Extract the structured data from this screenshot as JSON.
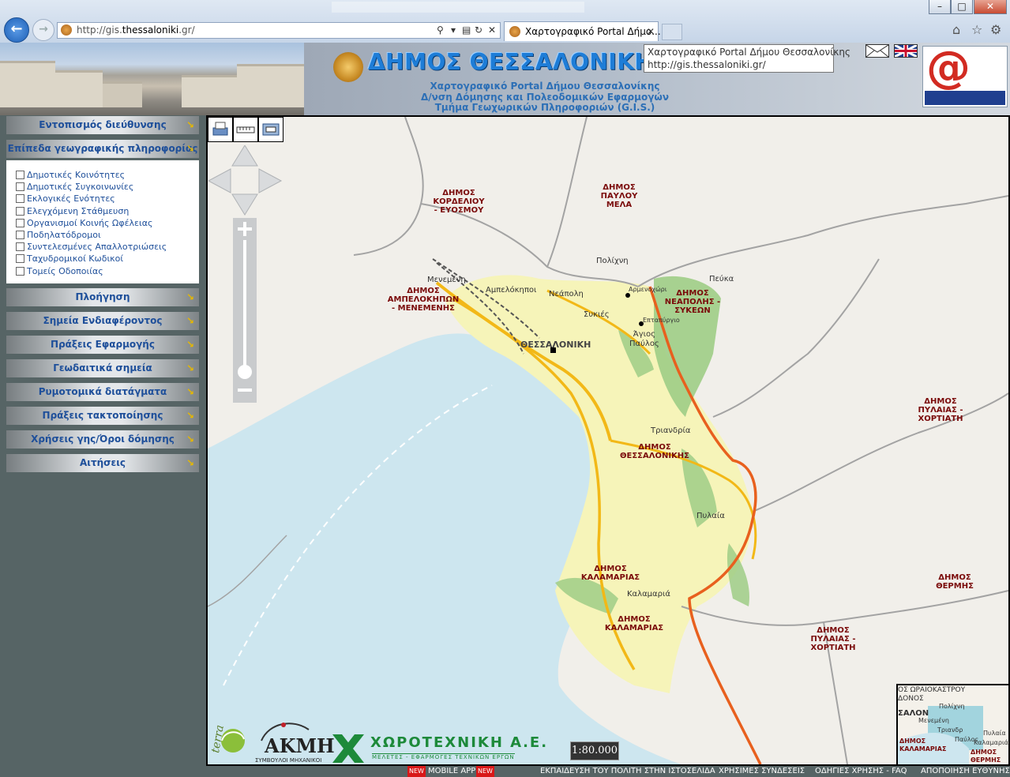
{
  "browser": {
    "url_prefix": "http://gis.",
    "url_domain": "thessaloniki",
    "url_suffix": ".gr/",
    "tab_title": "Χαρτογραφικό Portal Δήμο...",
    "window_minimize": "–",
    "window_maximize": "□",
    "window_close": "✕"
  },
  "header": {
    "title": "ΔΗΜΟΣ ΘΕΣΣΑΛΟΝΙΚΗΣ",
    "subtitle_1": "Χαρτογραφικό Portal Δήμου Θεσσαλονίκης",
    "subtitle_2": "Δ/νση Δόμησης και Πολεοδομικών Εφαρμογών",
    "subtitle_3": "Τμήμα Γεωχωρικών Πληροφοριών (G.I.S.)",
    "tooltip_line1": "Χαρτογραφικό Portal Δήμου Θεσσαλονίκης",
    "tooltip_line2": "http://gis.thessaloniki.gr/"
  },
  "sidebar": {
    "locate_address": "Εντοπισμός διεύθυνσης",
    "geo_layers": "Επίπεδα γεωγραφικής πληροφορίας",
    "layers": [
      "Δημοτικές Κοινότητες",
      "Δημοτικές Συγκοινωνίες",
      "Εκλογικές Ενότητες",
      "Ελεγχόμενη Στάθμευση",
      "Οργανισμοί Κοινής Ωφέλειας",
      "Ποδηλατόδρομοι",
      "Συντελεσμένες Απαλλοτριώσεις",
      "Ταχυδρομικοί Κωδικοί",
      "Τομείς Οδοποιίας"
    ],
    "menu": [
      "Πλοήγηση",
      "Σημεία Ενδιαφέροντος",
      "Πράξεις Εφαρμογής",
      "Γεωδαιτικά σημεία",
      "Ρυμοτομικά διατάγματα",
      "Πράξεις τακτοποίησης",
      "Χρήσεις γης/Όροι δόμησης",
      "Αιτήσεις"
    ],
    "arrow": "↘"
  },
  "map": {
    "scale": "1:80.000",
    "municipalities": {
      "kordelio": "ΔΗΜΟΣ\nΚΟΡΔΕΛΙΟΥ\n- ΕΥΟΣΜΟΥ",
      "pavlou_mela": "ΔΗΜΟΣ\nΠΑΥΛΟΥ\nΜΕΛΑ",
      "ampelokipoi": "ΔΗΜΟΣ\nΑΜΠΕΛΟΚΗΠΩΝ\n- ΜΕΝΕΜΕΝΗΣ",
      "neapoli": "ΔΗΜΟΣ\nΝΕΑΠΟΛΗΣ -\nΣΥΚΕΩΝ",
      "thessaloniki": "ΔΗΜΟΣ\nΘΕΣΣΑΛΟΝΙΚΗΣ",
      "pylaia_1": "ΔΗΜΟΣ\nΠΥΛΑΙΑΣ -\nΧΟΡΤΙΑΤΗ",
      "pylaia_2": "ΔΗΜΟΣ\nΠΥΛΑΙΑΣ -\nΧΟΡΤΙΑΤΗ",
      "kalamaria_1": "ΔΗΜΟΣ\nΚΑΛΑΜΑΡΙΑΣ",
      "kalamaria_2": "ΔΗΜΟΣ\nΚΑΛΑΜΑΡΙΑΣ",
      "thermi": "ΔΗΜΟΣ\nΘΕΡΜΗΣ"
    },
    "places": {
      "polichni": "Πολίχνη",
      "pefka": "Πεύκα",
      "menemeni": "Μενεμένη",
      "ampelokipoi": "Αμπελόκηποι",
      "neapoli": "Νεάπολη",
      "armenochori": "Αρμενοχώρι",
      "sykies": "Συκιές",
      "eptapyrgio": "Επταπύργιο",
      "agios_pavlos": "Άγιος\nΠαύλος",
      "thessaloniki": "ΘΕΣΣΑΛΟΝΙΚΗ",
      "triandria": "Τριανδρία",
      "pylaia": "Πυλαία",
      "kalamaria": "Καλαμαριά"
    },
    "overview": {
      "line1": "ΟΣ ΩΡΑΙΟΚΑΣΤΡΟΥ",
      "line2": "ΔΟΝΟΣ",
      "line3": "ΣΑΛΟΝ",
      "line4": "ΔΗΜΟΣ",
      "line5": "ΚΑΛΑΜΑΡΙΑΣ",
      "line6": "ΔΗΜΟΣ",
      "line7": "ΘΕΡΜΗΣ",
      "place1": "Πολίχνη",
      "place2": "Μενεμένη",
      "place3": "Τριανδρ",
      "place4": "Παύλος",
      "place5": "Πυλαία",
      "place6": "Καλαμαριά"
    }
  },
  "logos": {
    "terra": "terra",
    "akmi": "ΑΚΜΗ",
    "akmi_sub": "ΣΥΜΒΟΥΛΟΙ ΜΗΧΑΝΙΚΟΙ",
    "chorotechniki": "ΧΩΡΟΤΕΧΝΙΚΗ Α.Ε.",
    "chorotechniki_sub": "ΜΕΛΕΤΕΣ - ΕΦΑΡΜΟΓΕΣ ΤΕΧΝΙΚΩΝ ΕΡΓΩΝ"
  },
  "footer": {
    "new": "NEW",
    "mobile_app": "MOBILE APP",
    "education": "ΕΚΠΑΙΔΕΥΣΗ ΤΟΥ ΠΟΛΙΤΗ ΣΤΗΝ ΙΣΤΟΣΕΛΙΔΑ",
    "links": "ΧΡΗΣΙΜΕΣ ΣΥΝΔΕΣΕΙΣ",
    "faq": "ΟΔΗΓΙΕΣ ΧΡΗΣΗΣ - FAQ",
    "disclaimer": "ΑΠΟΠΟΙΗΣΗ ΕΥΘΥΝΗΣ"
  },
  "colors": {
    "sea": "#cde6ef",
    "land": "#f1efea",
    "urban": "#f6f4b9",
    "green": "#9fcd86",
    "highway": "#e8601e",
    "road": "#f2b817",
    "boundary": "#a3a3a3",
    "label_dark_red": "#7a0a0a",
    "link_blue": "#1e4f9a"
  }
}
